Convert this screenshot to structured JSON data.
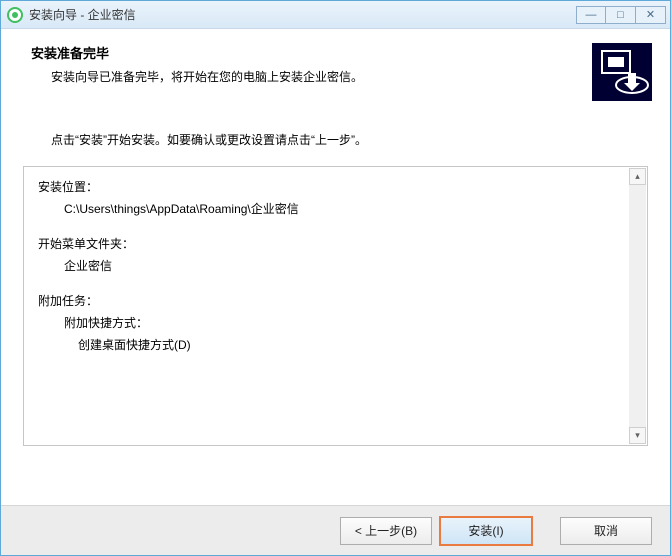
{
  "window": {
    "title": "安装向导 - 企业密信"
  },
  "header": {
    "title": "安装准备完毕",
    "subtitle": "安装向导已准备完毕，将开始在您的电脑上安装企业密信。"
  },
  "instruction": "点击“安装”开始安装。如要确认或更改设置请点击“上一步”。",
  "details": {
    "install_location_label": "安装位置：",
    "install_location_value": "C:\\Users\\things\\AppData\\Roaming\\企业密信",
    "start_menu_label": "开始菜单文件夹：",
    "start_menu_value": "企业密信",
    "additional_tasks_label": "附加任务：",
    "additional_shortcut_label": "附加快捷方式：",
    "create_desktop_shortcut": "创建桌面快捷方式(D)"
  },
  "buttons": {
    "back": "< 上一步(B)",
    "install": "安装(I)",
    "cancel": "取消"
  },
  "win_controls": {
    "minimize": "—",
    "maximize": "□",
    "close": "✕"
  },
  "scrollbar": {
    "up": "▴",
    "down": "▾"
  }
}
